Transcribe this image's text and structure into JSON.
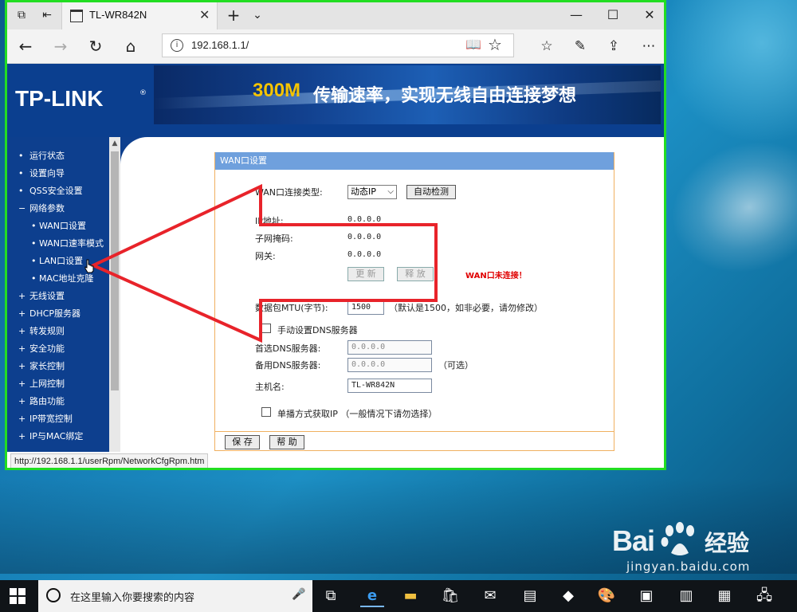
{
  "browser": {
    "tab_title": "TL-WR842N",
    "address": "192.168.1.1/",
    "status_url": "http://192.168.1.1/userRpm/NetworkCfgRpm.htm"
  },
  "banner": {
    "logo": "TP-LINK",
    "logo_mark": "®",
    "slogan_number": "300M",
    "slogan_text": "传输速率，实现无线自由连接梦想"
  },
  "sidebar": {
    "items": [
      {
        "marker": "•",
        "label": "运行状态"
      },
      {
        "marker": "•",
        "label": "设置向导"
      },
      {
        "marker": "•",
        "label": "QSS安全设置"
      },
      {
        "marker": "−",
        "label": "网络参数"
      },
      {
        "marker": "•",
        "label": "WAN口设置",
        "sub": true
      },
      {
        "marker": "•",
        "label": "WAN口速率模式",
        "sub": true
      },
      {
        "marker": "•",
        "label": "LAN口设置",
        "sub": true
      },
      {
        "marker": "•",
        "label": "MAC地址克隆",
        "sub": true
      },
      {
        "marker": "+",
        "label": "无线设置"
      },
      {
        "marker": "+",
        "label": "DHCP服务器"
      },
      {
        "marker": "+",
        "label": "转发规则"
      },
      {
        "marker": "+",
        "label": "安全功能"
      },
      {
        "marker": "+",
        "label": "家长控制"
      },
      {
        "marker": "+",
        "label": "上网控制"
      },
      {
        "marker": "+",
        "label": "路由功能"
      },
      {
        "marker": "+",
        "label": "IP带宽控制"
      },
      {
        "marker": "+",
        "label": "IP与MAC绑定"
      }
    ]
  },
  "wan": {
    "title": "WAN口设置",
    "conn_type_label": "WAN口连接类型:",
    "conn_type_value": "动态IP",
    "auto_detect": "自动检测",
    "ip_label": "IP地址:",
    "ip_value": "0.0.0.0",
    "mask_label": "子网掩码:",
    "mask_value": "0.0.0.0",
    "gateway_label": "网关:",
    "gateway_value": "0.0.0.0",
    "renew": "更 新",
    "release": "释 放",
    "status_warning": "WAN口未连接！",
    "mtu_label": "数据包MTU(字节):",
    "mtu_value": "1500",
    "mtu_hint": "（默认是1500，如非必要，请勿修改）",
    "manual_dns_label": "手动设置DNS服务器",
    "dns1_label": "首选DNS服务器:",
    "dns1_value": "0.0.0.0",
    "dns2_label": "备用DNS服务器:",
    "dns2_value": "0.0.0.0",
    "dns2_hint": "（可选）",
    "host_label": "主机名:",
    "host_value": "TL-WR842N",
    "unicast_label": "单播方式获取IP （一般情况下请勿选择）",
    "save": "保 存",
    "help": "帮 助"
  },
  "taskbar": {
    "search_placeholder": "在这里输入你要搜索的内容"
  },
  "watermark": {
    "brand": "Bai",
    "brand_cn": "经验",
    "url": "jingyan.baidu.com"
  },
  "colors": {
    "border_highlight": "#22dd22",
    "annotation_arrow": "#e8232a",
    "sidebar_bg": "#0d3f8e",
    "panel_header": "#6fa0dd"
  }
}
